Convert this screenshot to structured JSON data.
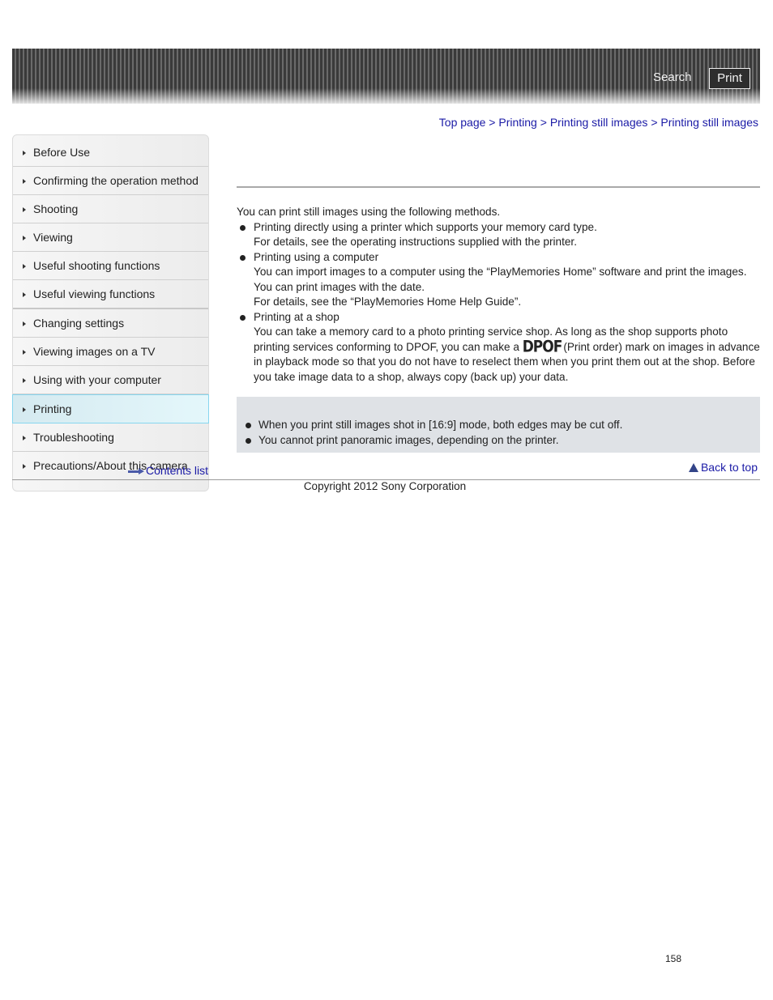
{
  "header": {
    "search_label": "Search",
    "print_label": "Print"
  },
  "breadcrumb": [
    {
      "label": "Top page"
    },
    {
      "label": "Printing"
    },
    {
      "label": "Printing still images"
    },
    {
      "label": "Printing still images"
    }
  ],
  "breadcrumb_separator": ">",
  "sidebar": {
    "items": [
      {
        "label": "Before Use"
      },
      {
        "label": "Confirming the operation method"
      },
      {
        "label": "Shooting"
      },
      {
        "label": "Viewing"
      },
      {
        "label": "Useful shooting functions"
      },
      {
        "label": "Useful viewing functions"
      },
      {
        "label": "Changing settings"
      },
      {
        "label": "Viewing images on a TV"
      },
      {
        "label": "Using with your computer"
      },
      {
        "label": "Printing",
        "active": true
      },
      {
        "label": "Troubleshooting"
      },
      {
        "label": "Precautions/About this camera"
      }
    ],
    "contents_link": "Contents list"
  },
  "main": {
    "intro": "You can print still images using the following methods.",
    "methods": [
      {
        "title": "Printing directly using a printer which supports your memory card type.",
        "lines": [
          "For details, see the operating instructions supplied with the printer."
        ]
      },
      {
        "title": "Printing using a computer",
        "lines": [
          "You can import images to a computer using the “PlayMemories Home” software and print the images. You can print images with the date.",
          "For details, see the “PlayMemories Home Help Guide”."
        ]
      },
      {
        "title": "Printing at a shop",
        "text_before_icon": "You can take a memory card to a photo printing service shop. As long as the shop supports photo printing services conforming to DPOF, you can make a",
        "icon_label": "DPOF",
        "icon_name": "dpof-icon",
        "text_after_icon": "(Print order) mark on images in advance in playback mode so that you do not have to reselect them when you print them out at the shop. Before you take image data to a shop, always copy (back up) your data."
      }
    ],
    "notes": [
      "When you print still images shot in [16:9] mode, both edges may be cut off.",
      "You cannot print panoramic images, depending on the printer."
    ],
    "back_to_top": "Back to top"
  },
  "footer": {
    "copyright": "Copyright 2012 Sony Corporation",
    "page_number": "158"
  }
}
